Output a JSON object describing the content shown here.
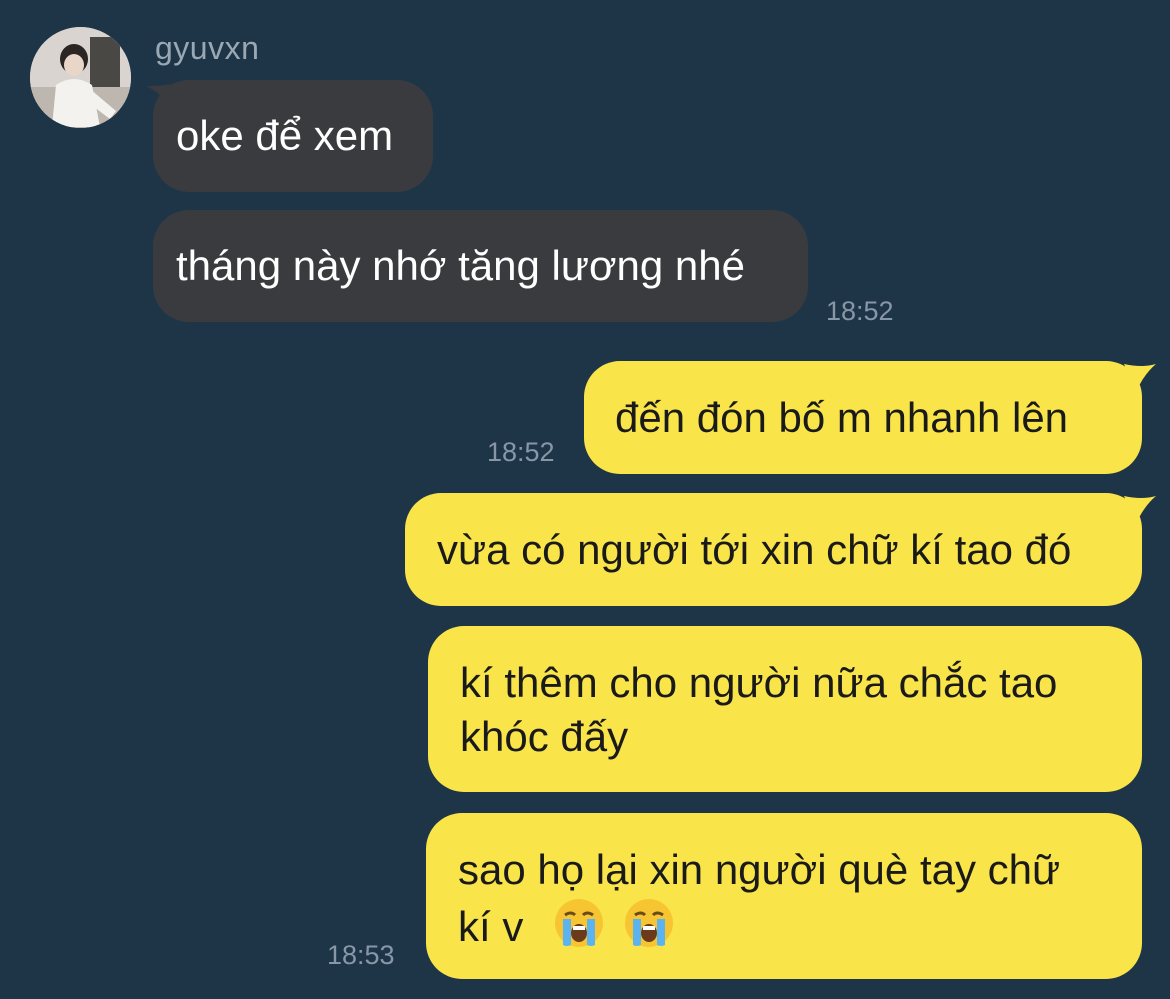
{
  "contact": {
    "name": "gyuvxn"
  },
  "messages": [
    {
      "direction": "incoming",
      "text": "oke để xem"
    },
    {
      "direction": "incoming",
      "text": "tháng này nhớ tăng lương nhé",
      "time": "18:52"
    },
    {
      "direction": "outgoing",
      "text": "đến đón bố m nhanh lên",
      "time": "18:52"
    },
    {
      "direction": "outgoing",
      "text": "vừa có người tới xin chữ kí tao đó"
    },
    {
      "direction": "outgoing",
      "text_line1": "kí thêm cho người nữa chắc tao",
      "text_line2": "khóc đấy"
    },
    {
      "direction": "outgoing",
      "text_line1": "sao họ lại xin người què tay chữ",
      "text_line2": "kí v",
      "emoji": [
        "loudly-crying-face",
        "loudly-crying-face"
      ],
      "time": "18:53"
    }
  ],
  "colors": {
    "background": "#1e3548",
    "incoming_bubble": "#3a3b3e",
    "outgoing_bubble": "#f9e44a",
    "timestamp": "#8797a6"
  }
}
